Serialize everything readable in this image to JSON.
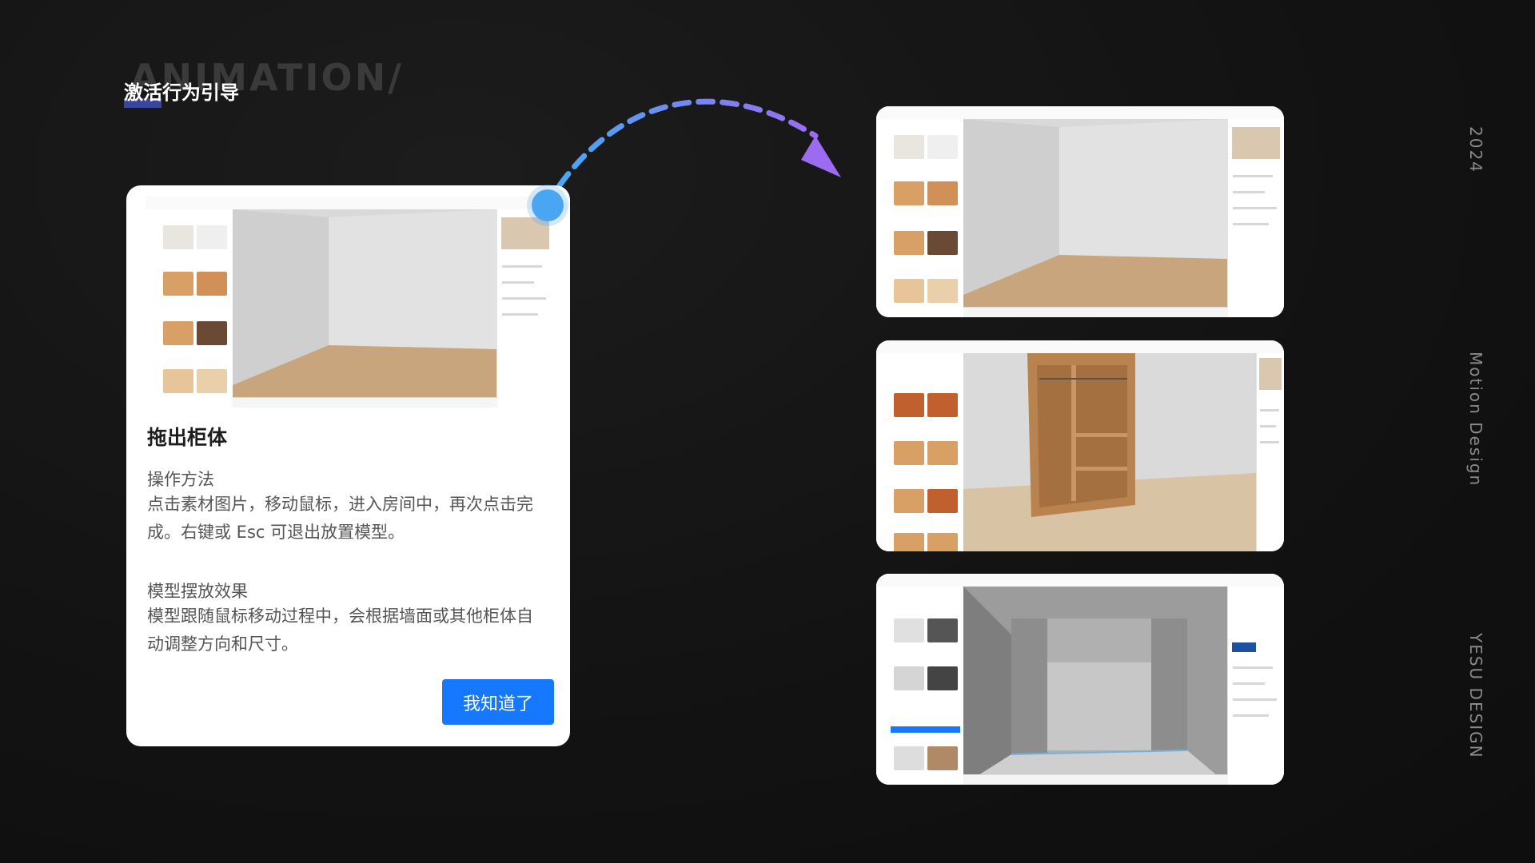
{
  "header": {
    "watermark": "ANIMATION/",
    "title": "激活行为引导"
  },
  "side_text": {
    "year": "2024",
    "motion": "Motion Design",
    "brand": "YESU DESIGN"
  },
  "card": {
    "title": "拖出柜体",
    "section1_heading": "操作方法",
    "section1_body": "点击素材图片，移动鼠标，进入房间中，再次点击完成。右键或 Esc 可退出放置模型。",
    "section2_heading": "模型摆放效果",
    "section2_body": "模型跟随鼠标移动过程中，会根据墙面或其他柜体自动调整方向和尺寸。",
    "button": "我知道了"
  },
  "colors": {
    "accent_blue": "#1677ff",
    "arrow_gradient_start": "#4aa6f3",
    "arrow_gradient_end": "#9b6cf0",
    "wood": "#d9a066",
    "floor": "#c8a57d"
  },
  "icons": [
    "cursor-dot-icon",
    "dashed-arrow-icon"
  ]
}
